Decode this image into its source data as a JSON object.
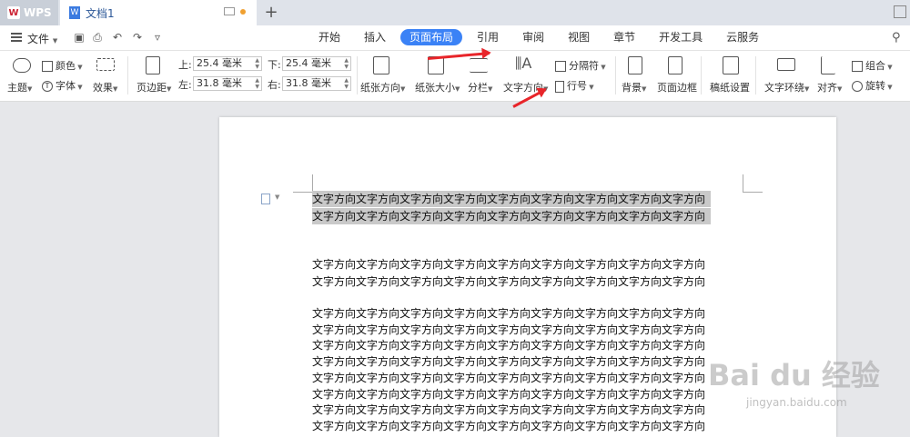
{
  "titlebar": {
    "app_tab": "WPS",
    "doc_tab": "文档1",
    "new_tab": "+"
  },
  "menubar": {
    "file": "文件",
    "tabs": [
      "开始",
      "插入",
      "页面布局",
      "引用",
      "审阅",
      "视图",
      "章节",
      "开发工具",
      "云服务"
    ],
    "active_tab": "页面布局"
  },
  "ribbon": {
    "theme": "主题",
    "color": "颜色",
    "font": "字体",
    "effect": "效果",
    "margins": "页边距",
    "top_label": "上:",
    "top_value": "25.4 毫米",
    "bottom_label": "下:",
    "bottom_value": "25.4 毫米",
    "left_label": "左:",
    "left_value": "31.8 毫米",
    "right_label": "右:",
    "right_value": "31.8 毫米",
    "orientation": "纸张方向",
    "size": "纸张大小",
    "columns": "分栏",
    "text_direction": "文字方向",
    "breaks": "分隔符",
    "line_numbers": "行号",
    "background": "背景",
    "page_borders": "页面边框",
    "manuscript": "稿纸设置",
    "wrap_text": "文字环绕",
    "align": "对齐",
    "group": "组合",
    "rotate": "旋转"
  },
  "document": {
    "text_line": "文字方向文字方向文字方向文字方向文字方向文字方向文字方向文字方向文字方向",
    "selected_lines": 2,
    "para2_lines": 2,
    "para3_lines": 8
  },
  "watermark": {
    "brand": "Bai du 经验",
    "url": "jingyan.baidu.com"
  },
  "colors": {
    "accent": "#3b82f6",
    "arrow": "#e8252a",
    "selection": "#c9c9c9"
  }
}
